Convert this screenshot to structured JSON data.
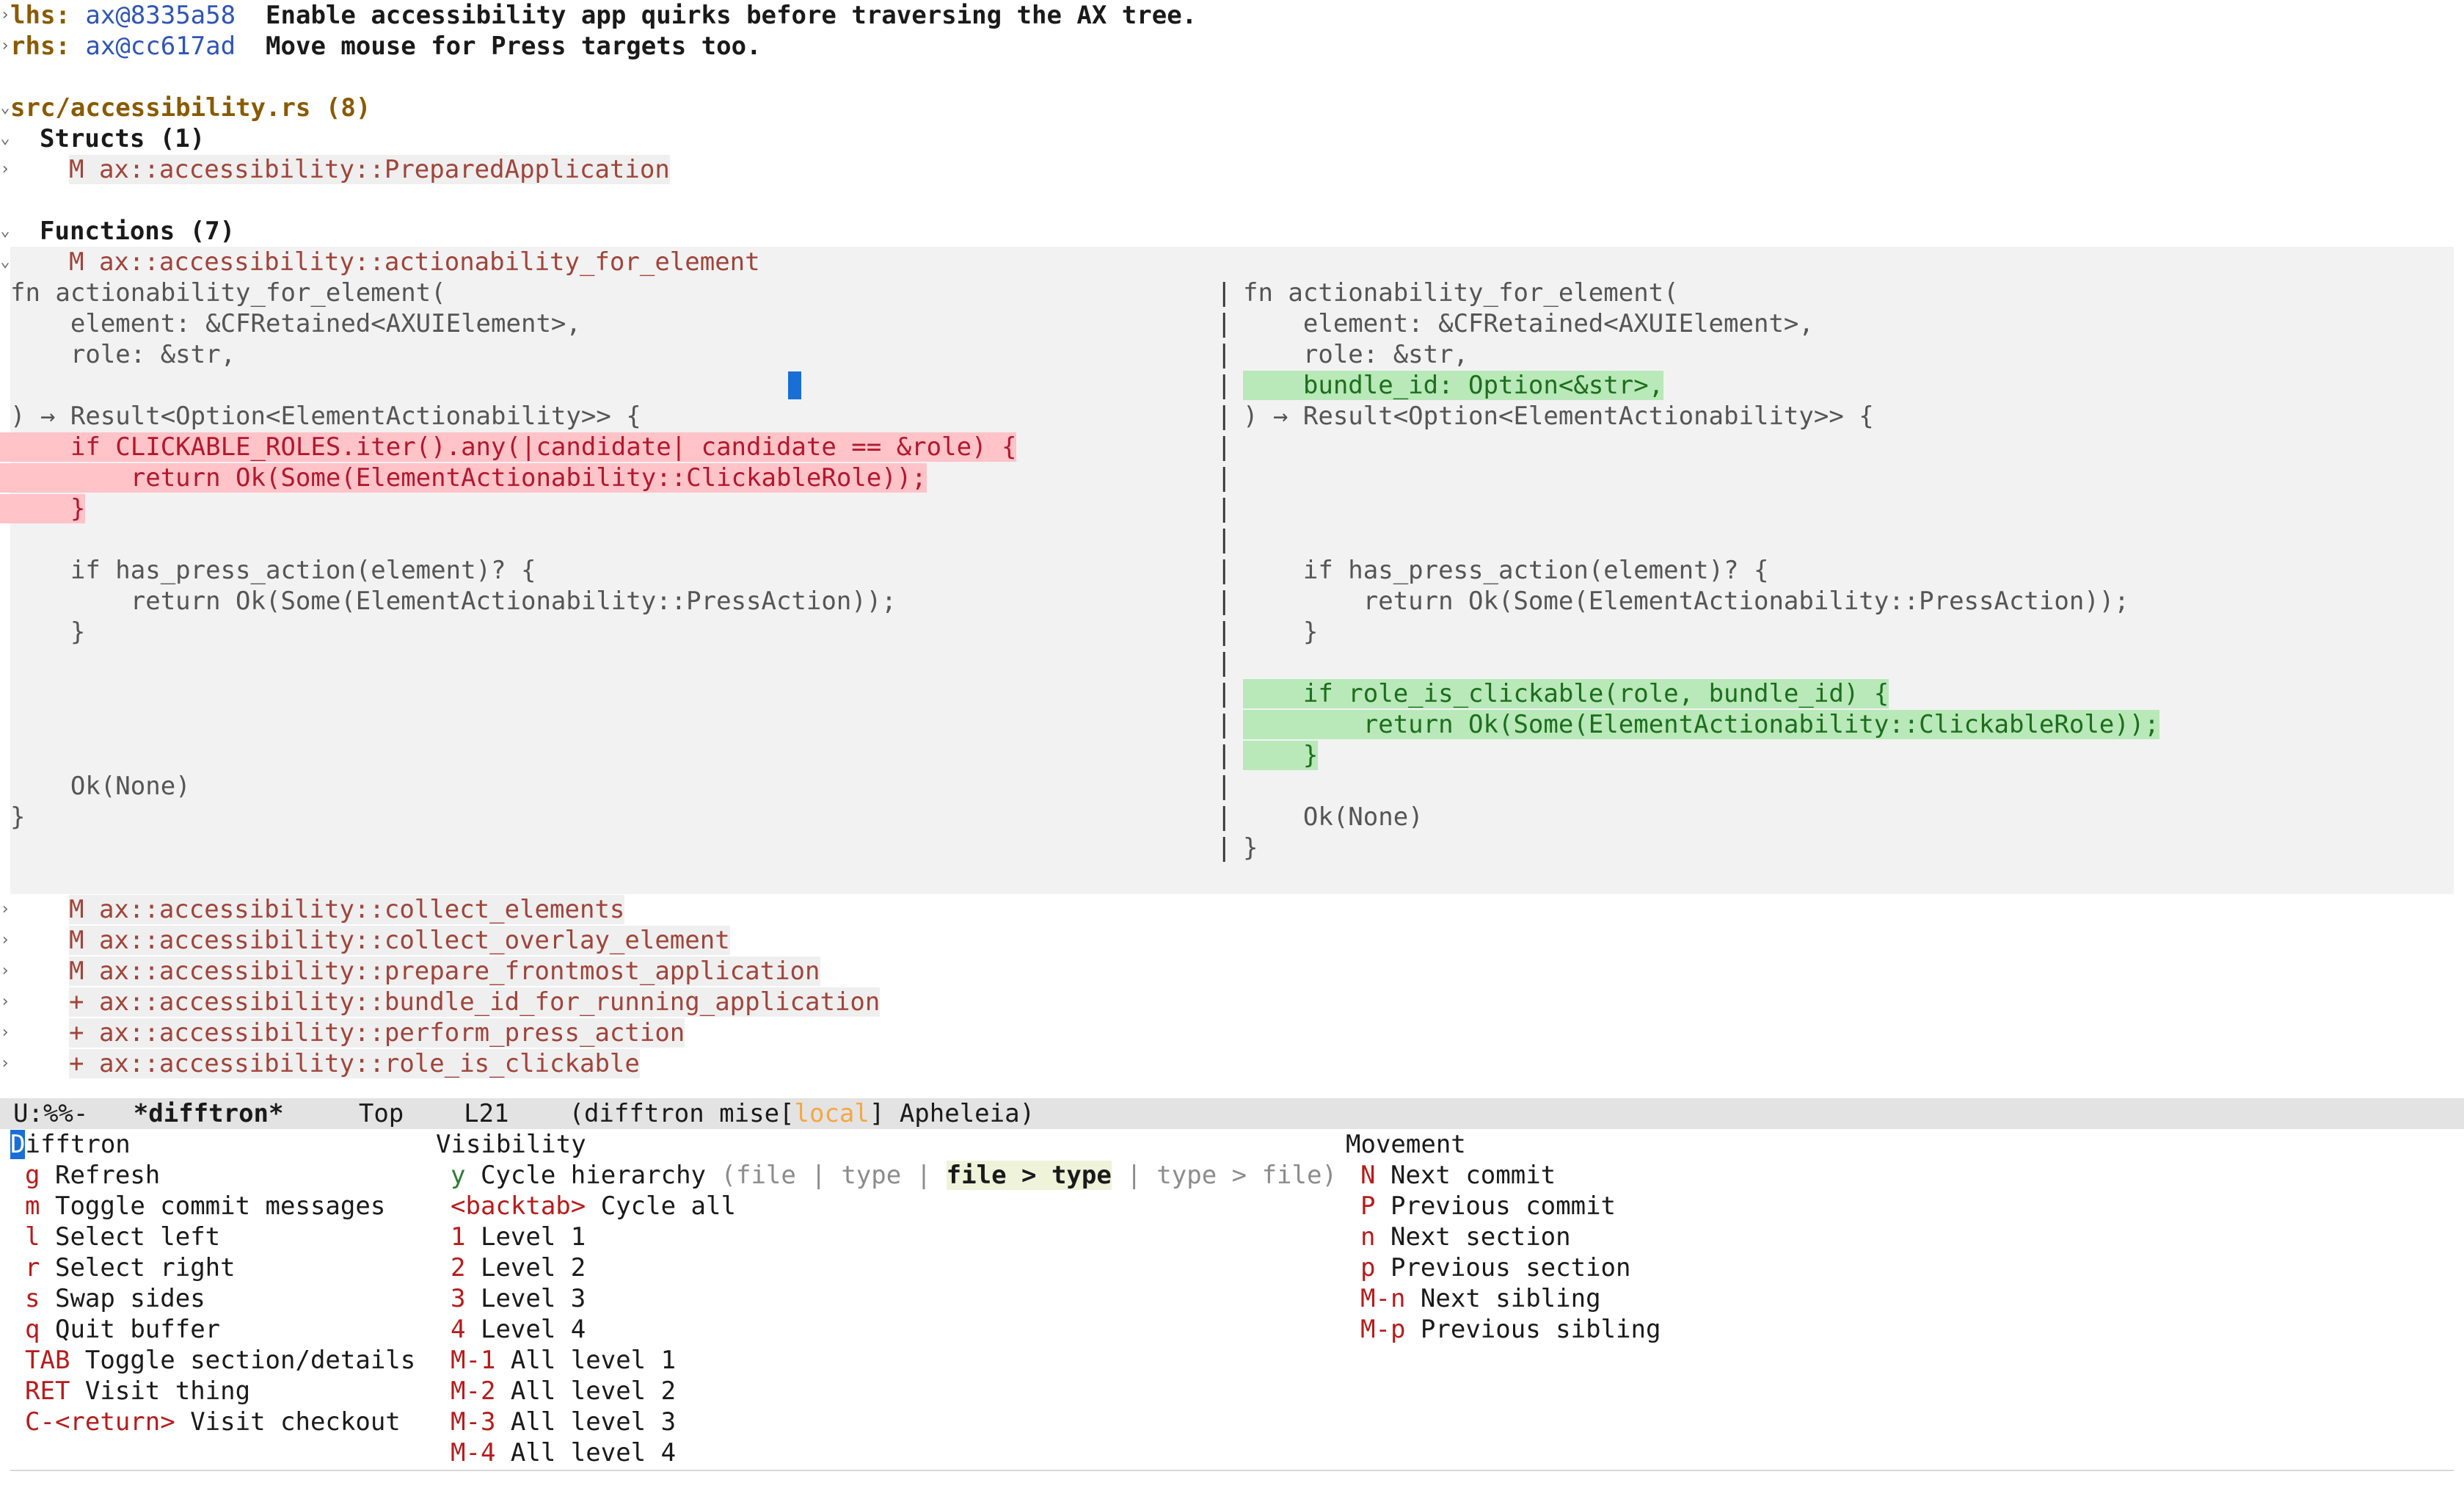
{
  "header": {
    "lhs_label": "lhs:",
    "lhs_commit": "ax@8335a58",
    "lhs_message": "Enable accessibility app quirks before traversing the AX tree.",
    "rhs_label": "rhs:",
    "rhs_commit": "ax@cc617ad",
    "rhs_message": "Move mouse for Press targets too."
  },
  "file": {
    "path": "src/accessibility.rs",
    "count": "(8)"
  },
  "sections": {
    "structs_label": "Structs (1)",
    "struct_item": "M ax::accessibility::PreparedApplication",
    "functions_label": "Functions (7)",
    "function_open": "M ax::accessibility::actionability_for_element"
  },
  "left_code": [
    "fn actionability_for_element(",
    "    element: &CFRetained<AXUIElement>,",
    "    role: &str,",
    "",
    ") → Result<Option<ElementActionability>> {",
    "    if CLICKABLE_ROLES.iter().any(|candidate| candidate == &role) {",
    "        return Ok(Some(ElementActionability::ClickableRole));",
    "    }",
    "",
    "    if has_press_action(element)? {",
    "        return Ok(Some(ElementActionability::PressAction));",
    "    }",
    "",
    "",
    "",
    "",
    "    Ok(None)",
    "}"
  ],
  "right_code": [
    "fn actionability_for_element(",
    "    element: &CFRetained<AXUIElement>,",
    "    role: &str,",
    "    bundle_id: Option<&str>,",
    ") → Result<Option<ElementActionability>> {",
    "",
    "",
    "",
    "",
    "    if has_press_action(element)? {",
    "        return Ok(Some(ElementActionability::PressAction));",
    "    }",
    "",
    "    if role_is_clickable(role, bundle_id) {",
    "        return Ok(Some(ElementActionability::ClickableRole));",
    "    }",
    "",
    "    Ok(None)",
    "}"
  ],
  "other_functions": [
    "M ax::accessibility::collect_elements",
    "M ax::accessibility::collect_overlay_element",
    "M ax::accessibility::prepare_frontmost_application",
    "+ ax::accessibility::bundle_id_for_running_application",
    "+ ax::accessibility::perform_press_action",
    "+ ax::accessibility::role_is_clickable"
  ],
  "modeline": {
    "status": "U:%%-",
    "buffer": "*difftron*",
    "position": "Top",
    "line": "L21",
    "modes_prefix": "(difftron mise[",
    "modes_local": "local",
    "modes_suffix": "] Apheleia)"
  },
  "help": {
    "col1_title_first": "D",
    "col1_title_rest": "ifftron",
    "col1": [
      {
        "key": "g",
        "label": "Refresh"
      },
      {
        "key": "m",
        "label": "Toggle commit messages"
      },
      {
        "key": "l",
        "label": "Select left"
      },
      {
        "key": "r",
        "label": "Select right"
      },
      {
        "key": "s",
        "label": "Swap sides"
      },
      {
        "key": "q",
        "label": "Quit buffer"
      },
      {
        "key": "TAB",
        "label": "Toggle section/details"
      },
      {
        "key": "RET",
        "label": "Visit thing"
      },
      {
        "key": "C-<return>",
        "label": "Visit checkout"
      }
    ],
    "col2_title": "Visibility",
    "cycle_key": "y",
    "cycle_label": "Cycle hierarchy",
    "cycle_opt_open": "(file",
    "cycle_sep1": "|",
    "cycle_opt2": "type",
    "cycle_sep2": "|",
    "cycle_opt3": "file > type",
    "cycle_sep3": "|",
    "cycle_opt4": "type > file)",
    "col2": [
      {
        "key": "<backtab>",
        "label": "Cycle all"
      },
      {
        "key": "1",
        "label": "Level 1"
      },
      {
        "key": "2",
        "label": "Level 2"
      },
      {
        "key": "3",
        "label": "Level 3"
      },
      {
        "key": "4",
        "label": "Level 4"
      },
      {
        "key": "M-1",
        "label": "All level 1"
      },
      {
        "key": "M-2",
        "label": "All level 2"
      },
      {
        "key": "M-3",
        "label": "All level 3"
      },
      {
        "key": "M-4",
        "label": "All level 4"
      }
    ],
    "col3_title": "Movement",
    "col3": [
      {
        "key": "N",
        "label": "Next commit"
      },
      {
        "key": "P",
        "label": "Previous commit"
      },
      {
        "key": "n",
        "label": "Next section"
      },
      {
        "key": "p",
        "label": "Previous section"
      },
      {
        "key": "M-n",
        "label": "Next sibling"
      },
      {
        "key": "M-p",
        "label": "Previous sibling"
      }
    ]
  }
}
